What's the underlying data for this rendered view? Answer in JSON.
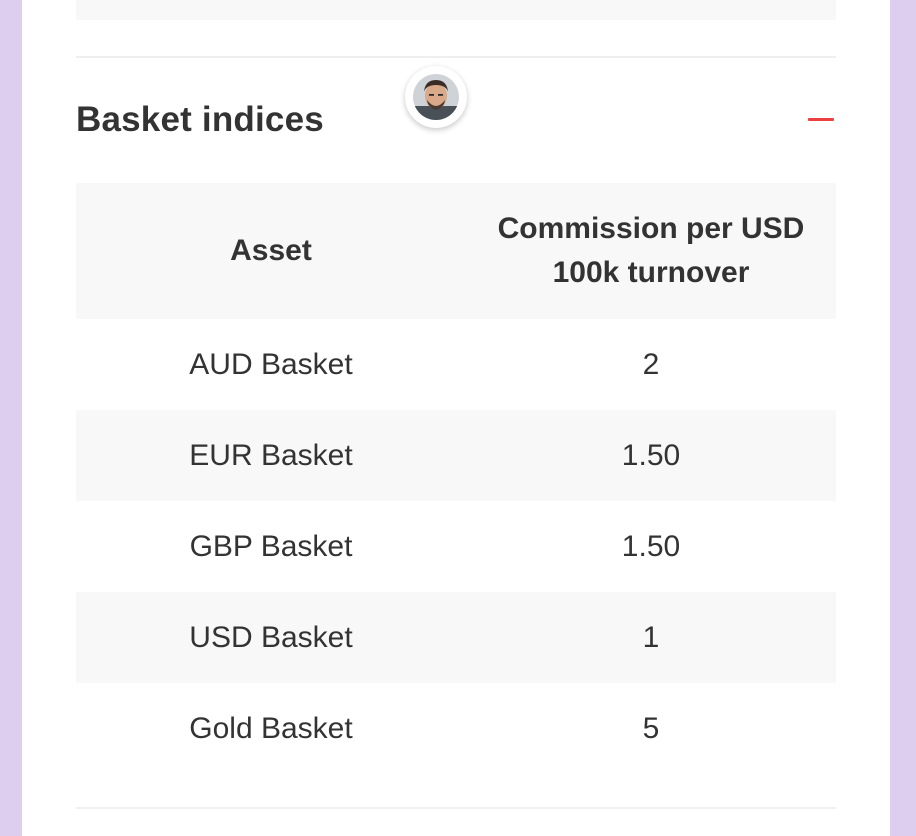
{
  "section": {
    "title": "Basket indices"
  },
  "table": {
    "headers": {
      "asset": "Asset",
      "commission": "Commission per USD 100k turnover"
    },
    "rows": [
      {
        "asset": "AUD Basket",
        "value": "2"
      },
      {
        "asset": "EUR Basket",
        "value": "1.50"
      },
      {
        "asset": "GBP Basket",
        "value": "1.50"
      },
      {
        "asset": "USD Basket",
        "value": "1"
      },
      {
        "asset": "Gold Basket",
        "value": "5"
      }
    ]
  },
  "colors": {
    "page_background": "#ddcdee",
    "card": "#ffffff",
    "row_shade": "#f8f8f8",
    "text": "#333333",
    "collapse_accent": "#ec3f3f"
  },
  "icons": {
    "collapse": "minus-icon",
    "agent": "avatar"
  }
}
